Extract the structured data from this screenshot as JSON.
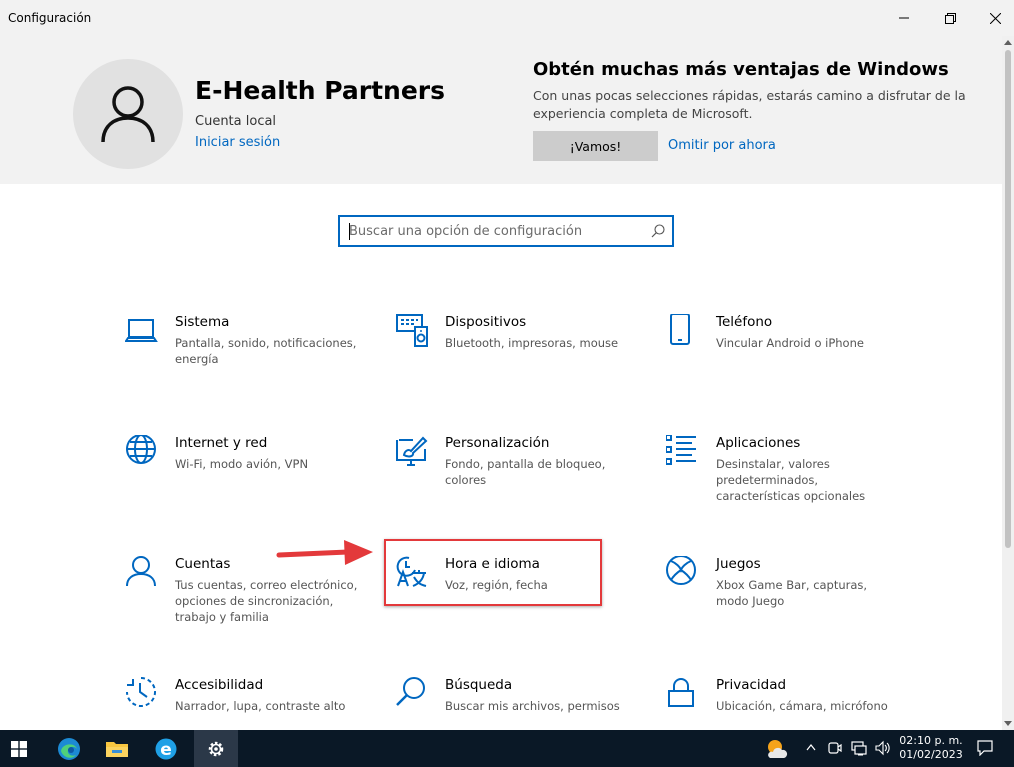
{
  "window": {
    "title": "Configuración"
  },
  "account": {
    "name": "E-Health Partners",
    "type": "Cuenta local",
    "signin_link": "Iniciar sesión"
  },
  "promo": {
    "title": "Obtén muchas más ventajas de Windows",
    "description": "Con unas pocas selecciones rápidas, estarás camino a disfrutar de la experiencia completa de Microsoft.",
    "go_button": "¡Vamos!",
    "skip_link": "Omitir por ahora"
  },
  "search": {
    "placeholder": "Buscar una opción de configuración",
    "value": ""
  },
  "categories": [
    {
      "name": "Sistema",
      "desc": "Pantalla, sonido, notificaciones, energía",
      "icon": "laptop-icon"
    },
    {
      "name": "Dispositivos",
      "desc": "Bluetooth, impresoras, mouse",
      "icon": "devices-icon"
    },
    {
      "name": "Teléfono",
      "desc": "Vincular Android o iPhone",
      "icon": "phone-icon"
    },
    {
      "name": "Internet y red",
      "desc": "Wi-Fi, modo avión, VPN",
      "icon": "globe-icon"
    },
    {
      "name": "Personalización",
      "desc": "Fondo, pantalla de bloqueo, colores",
      "icon": "paint-icon"
    },
    {
      "name": "Aplicaciones",
      "desc": "Desinstalar, valores predeterminados, características opcionales",
      "icon": "apps-list-icon"
    },
    {
      "name": "Cuentas",
      "desc": "Tus cuentas, correo electrónico, opciones de sincronización, trabajo y familia",
      "icon": "person-icon"
    },
    {
      "name": "Hora e idioma",
      "desc": "Voz, región, fecha",
      "icon": "time-language-icon"
    },
    {
      "name": "Juegos",
      "desc": "Xbox Game Bar, capturas, modo Juego",
      "icon": "xbox-icon"
    },
    {
      "name": "Accesibilidad",
      "desc": "Narrador, lupa, contraste alto",
      "icon": "accessibility-icon"
    },
    {
      "name": "Búsqueda",
      "desc": "Buscar mis archivos, permisos",
      "icon": "magnifier-icon"
    },
    {
      "name": "Privacidad",
      "desc": "Ubicación, cámara, micrófono",
      "icon": "lock-icon"
    }
  ],
  "taskbar": {
    "time": "02:10 p. m.",
    "date": "01/02/2023"
  },
  "colors": {
    "accent": "#0067c0",
    "annotation": "#e3393b",
    "taskbar": "#0a1826"
  }
}
